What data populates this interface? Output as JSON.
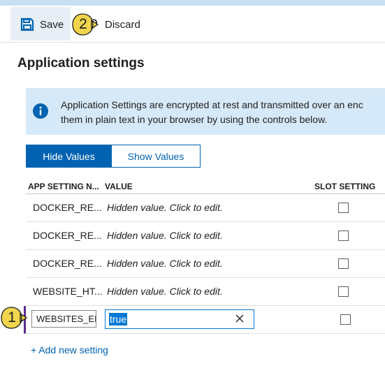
{
  "toolbar": {
    "save_label": "Save",
    "discard_label": "Discard",
    "save_icon": "floppy-disk-icon",
    "discard_icon": "undo-arrow-icon"
  },
  "callouts": {
    "first": "1",
    "second": "2"
  },
  "page": {
    "title": "Application settings"
  },
  "banner": {
    "icon": "info-icon",
    "line1": "Application Settings are encrypted at rest and transmitted over an enc",
    "line2": "them in plain text in your browser by using the controls below."
  },
  "toggle": {
    "hide_label": "Hide Values",
    "show_label": "Show Values",
    "active": "hide"
  },
  "table": {
    "headers": {
      "name": "APP SETTING N...",
      "value": "VALUE",
      "slot": "SLOT SETTING"
    },
    "rows": [
      {
        "name": "DOCKER_RE...",
        "value": "Hidden value. Click to edit."
      },
      {
        "name": "DOCKER_RE...",
        "value": "Hidden value. Click to edit."
      },
      {
        "name": "DOCKER_RE...",
        "value": "Hidden value. Click to edit."
      },
      {
        "name": "WEBSITE_HT...",
        "value": "Hidden value. Click to edit."
      }
    ],
    "edit_row": {
      "name_value": "WEBSITES_EN",
      "value_value": "true"
    }
  },
  "add_setting_label": "+ Add new setting",
  "colors": {
    "accent": "#0063b1",
    "callout": "#f2d54c",
    "banner": "#d6e9f8",
    "edit_marker": "#5c2d91"
  }
}
